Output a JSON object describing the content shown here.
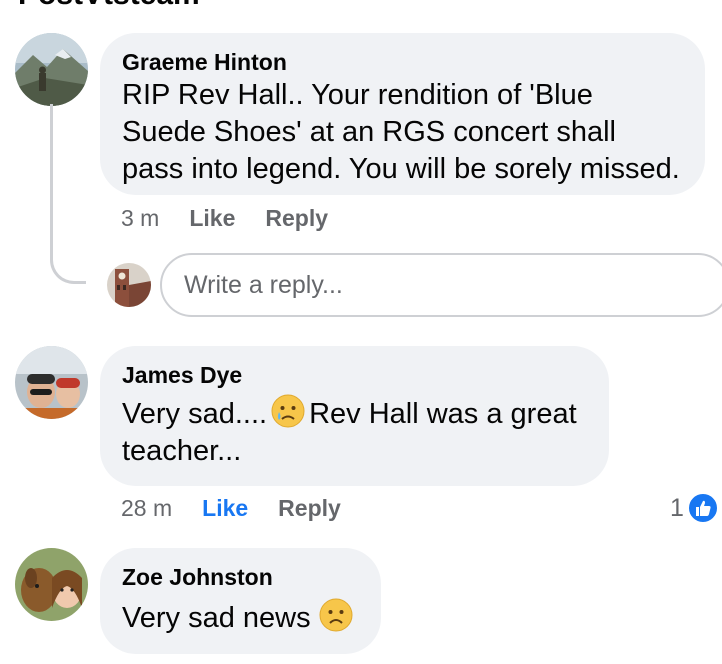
{
  "header_partial": "PostVtsteam",
  "comments": [
    {
      "author": "Graeme Hinton",
      "text": "RIP Rev Hall.. Your rendition of 'Blue Suede Shoes' at an RGS concert shall pass into legend. You will be sorely missed.",
      "time": "3 m",
      "like_label": "Like",
      "reply_label": "Reply",
      "avatar_icon": "mountain-hiker-avatar"
    },
    {
      "author": "James Dye",
      "text_before": "Very sad....",
      "text_after": "Rev Hall was a great teacher...",
      "emoji": "sad-tear-emoji",
      "time": "28 m",
      "like_label": "Like",
      "reply_label": "Reply",
      "reaction_count": "1",
      "reaction_icon": "like-thumb-icon",
      "avatar_icon": "couple-selfie-avatar"
    },
    {
      "author": "Zoe Johnston",
      "text": "Very sad news",
      "emoji": "frowning-emoji",
      "avatar_icon": "dog-selfie-avatar"
    }
  ],
  "reply_input": {
    "placeholder": "Write a reply...",
    "avatar_icon": "clock-tower-avatar"
  },
  "colors": {
    "bubble": "#f0f2f5",
    "meta_text": "#65676b",
    "like_active": "#1877f2",
    "text": "#050505"
  }
}
